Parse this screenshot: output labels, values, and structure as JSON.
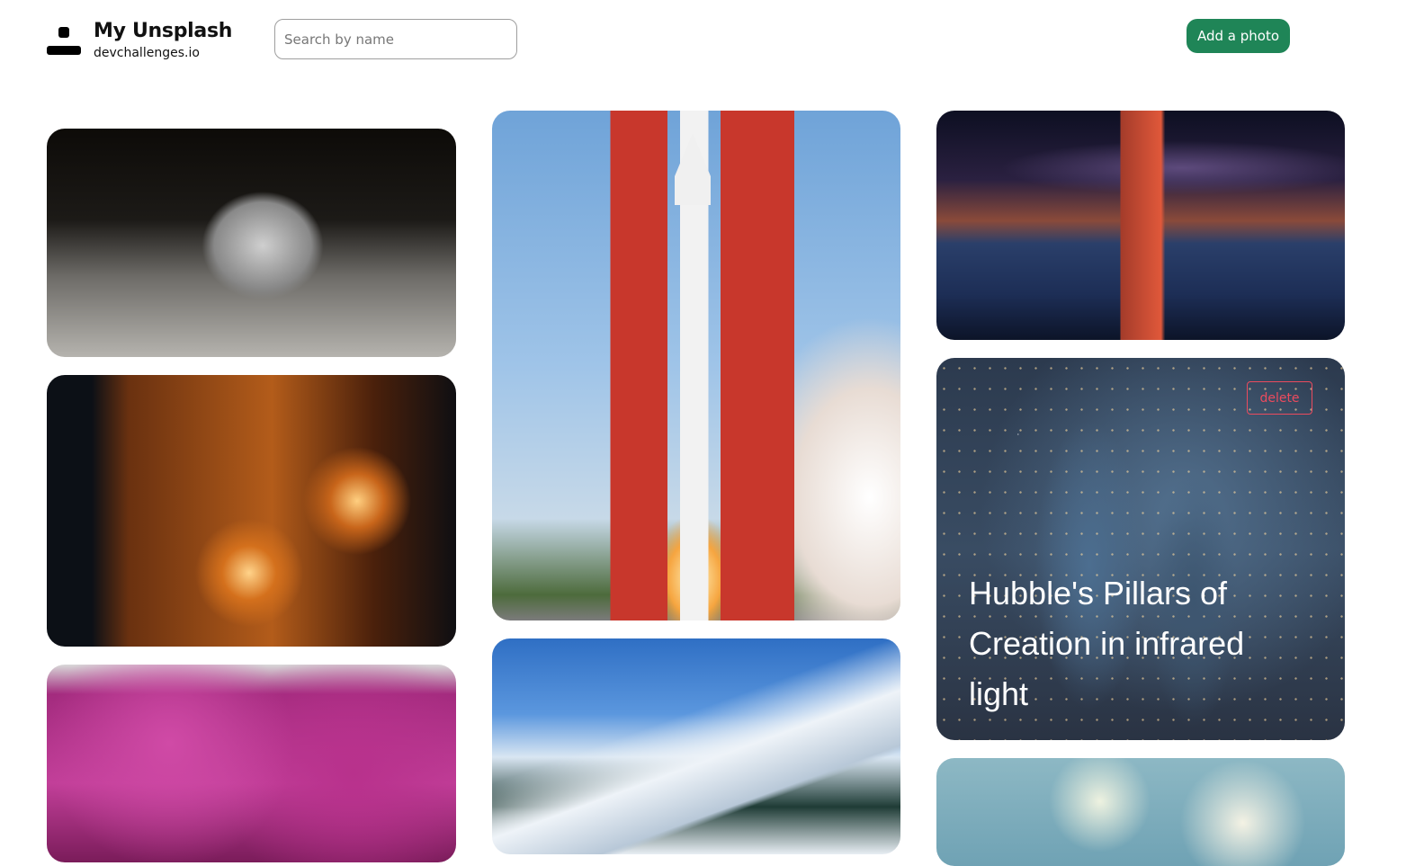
{
  "header": {
    "logo_icon": "logo-user-icon",
    "title": "My Unsplash",
    "subtitle": "devchallenges.io",
    "search_placeholder": "Search by name",
    "add_label": "Add a photo",
    "accent_color": "#1f8557"
  },
  "gallery": {
    "hovered": {
      "caption": "Hubble's Pillars of Creation in infrared light",
      "delete_label": "delete",
      "delete_color": "#eb4b5e"
    }
  }
}
